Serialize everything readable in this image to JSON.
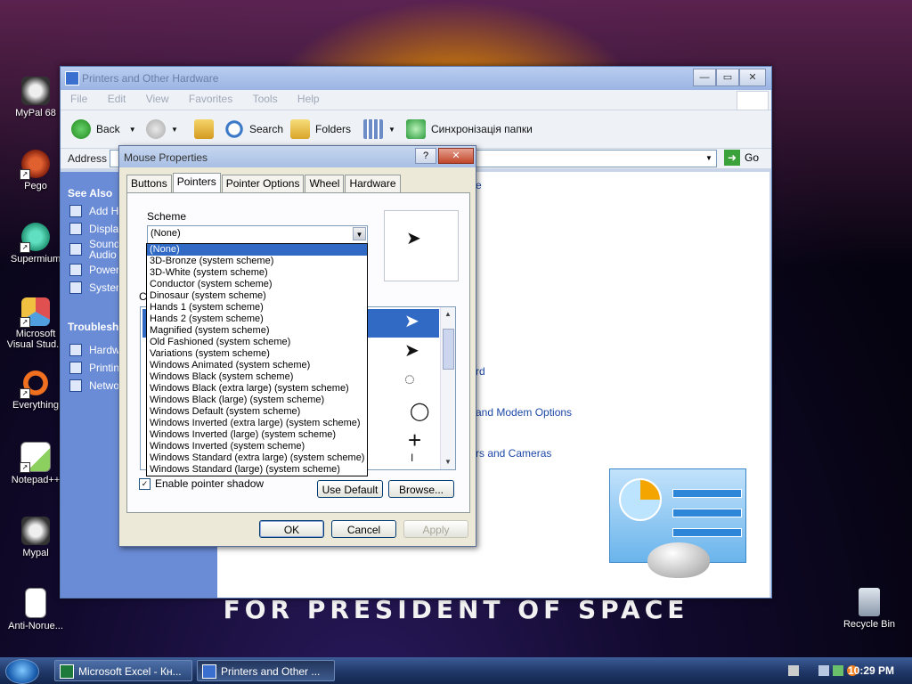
{
  "wallpaper": {
    "slogan": "FOR PRESIDENT OF SPACE"
  },
  "desktop_icons": [
    {
      "label": "MyPal 68"
    },
    {
      "label": "Pego"
    },
    {
      "label": "Supermium"
    },
    {
      "label": "Microsoft Visual Stud..."
    },
    {
      "label": "Everything"
    },
    {
      "label": "Notepad++"
    },
    {
      "label": "Mypal"
    },
    {
      "label": "Anti-Norue..."
    },
    {
      "label": "Recycle Bin"
    }
  ],
  "explorer": {
    "title": "Printers and Other Hardware",
    "menu": [
      "File",
      "Edit",
      "View",
      "Favorites",
      "Tools",
      "Help"
    ],
    "toolbar": {
      "back": "Back",
      "search": "Search",
      "folders": "Folders",
      "sync": "Синхронізація папки"
    },
    "address_label": "Address",
    "go_label": "Go",
    "taskpane": {
      "see_also_title": "See Also",
      "see_also": [
        "Add Ha",
        "Display",
        "Sound Audio",
        "Power",
        "System"
      ],
      "troubleshoot_title": "Troublesho",
      "troubleshoot": [
        "Hardw",
        "Printin",
        "Netwo"
      ]
    },
    "content_links": [
      "e",
      "rd",
      "and Modem Options",
      "rs and Cameras"
    ]
  },
  "dialog": {
    "title": "Mouse Properties",
    "help_btn": "?",
    "close_btn": "✕",
    "tabs": [
      "Buttons",
      "Pointers",
      "Pointer Options",
      "Wheel",
      "Hardware"
    ],
    "active_tab": "Pointers",
    "scheme_label": "Scheme",
    "scheme_value": "(None)",
    "customize_label": "C",
    "shadow_label": "Enable pointer shadow",
    "shadow_checked": true,
    "use_default": "Use Default",
    "browse": "Browse...",
    "ok": "OK",
    "cancel": "Cancel",
    "apply": "Apply"
  },
  "scheme_options": [
    "(None)",
    "3D-Bronze (system scheme)",
    "3D-White (system scheme)",
    "Conductor (system scheme)",
    "Dinosaur (system scheme)",
    "Hands 1 (system scheme)",
    "Hands 2 (system scheme)",
    "Magnified (system scheme)",
    "Old Fashioned (system scheme)",
    "Variations (system scheme)",
    "Windows Animated (system scheme)",
    "Windows Black  (system scheme)",
    "Windows Black (extra large) (system scheme)",
    "Windows Black (large) (system scheme)",
    "Windows Default (system scheme)",
    "Windows Inverted (extra large) (system scheme)",
    "Windows Inverted (large) (system scheme)",
    "Windows Inverted (system scheme)",
    "Windows Standard (extra large) (system scheme)",
    "Windows Standard (large) (system scheme)"
  ],
  "taskbar": {
    "tasks": [
      {
        "label": "Microsoft Excel - Кн..."
      },
      {
        "label": "Printers and Other ..."
      }
    ],
    "clock": "10:29 PM"
  },
  "colors": {
    "selection": "#316ac5",
    "taskpane": "#6a8bd6",
    "link": "#1c48a6"
  }
}
